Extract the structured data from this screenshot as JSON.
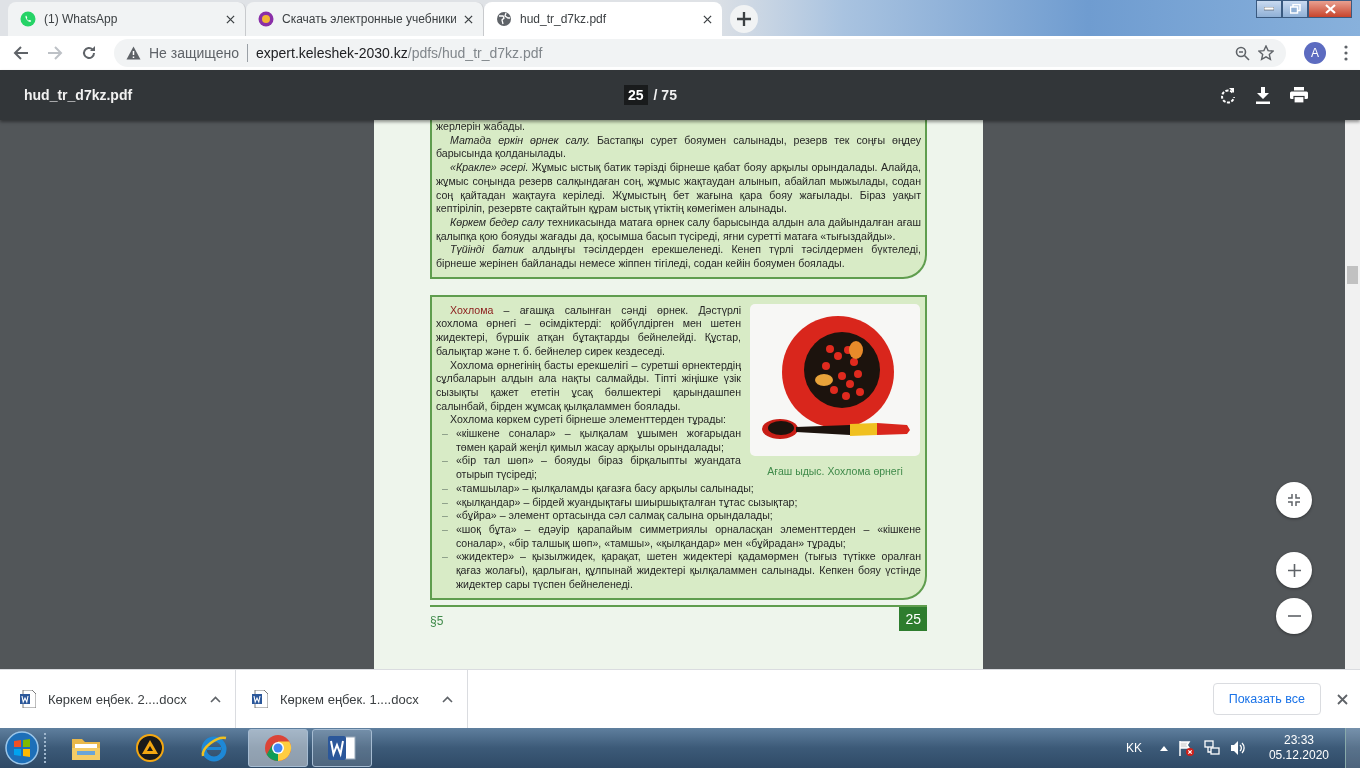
{
  "tabs": [
    {
      "title": "(1) WhatsApp",
      "kind": "whatsapp",
      "selected": false
    },
    {
      "title": "Скачать электронные учебники",
      "kind": "site",
      "selected": false
    },
    {
      "title": "hud_tr_d7kz.pdf",
      "kind": "globe",
      "selected": true
    }
  ],
  "address_bar": {
    "security_label": "Не защищено",
    "url_host": "expert.keleshek-2030.kz",
    "url_path": "/pdfs/hud_tr_d7kz.pdf",
    "profile_initial": "A"
  },
  "pdf_toolbar": {
    "file_name": "hud_tr_d7kz.pdf",
    "page_current": "25",
    "page_total": "/ 75"
  },
  "page": {
    "box_1": {
      "paragraphs": [
        {
          "text": "жерлерін жабады.",
          "indent": false
        },
        {
          "text": "*Матада еркін өрнек салу.* Бастапқы сурет бояумен салынады, резерв тек соңғы өңдеу барысында қолданылады.",
          "indent": true
        },
        {
          "text": "*«Кракле» әсері.* Жұмыс ыстық батик тәрізді бірнеше қабат бояу арқылы орындалады. Алайда, жұмыс соңында резерв салқындаған соң, жұмыс жақтаудан алынып, абайлап мыжылады, содан соң қайтадан жақтауға керіледі. Жұмыстың бет жағына қара бояу жағылады. Біраз уақыт кептіріліп, резервте сақтайтын құрам ыстық үтіктің көмегімен алынады.",
          "indent": true
        },
        {
          "text": "*Көркем бедер салу* техникасында матаға өрнек салу барысында алдын ала дайындалған ағаш қалыпқа қою бояуды жағады да, қосымша басып түсіреді, яғни суретті матаға «тығыздайды».",
          "indent": true
        },
        {
          "text": "*Түйінді батик* алдыңғы тәсілдерден ерекшеленеді. Кенеп түрлі тәсілдермен бүктеледі, бірнеше жерінен байланады немесе жіппен тігіледі, содан кейін бояумен боялады.",
          "indent": true
        }
      ]
    },
    "box_2": {
      "figure_caption": "Ағаш ыдыс. Хохлома өрнегі",
      "paragraphs": [
        {
          "text": "**Хохлома** – ағашқа салынған сәнді өрнек. Дәстүрлі хохлома өрнегі – өсімдіктерді: қойбүлдірген мен шетен жидектері, бүршік атқан бұтақтарды бейнелейді. Құстар, балықтар және т. б. бейнелер сирек кездеседі.",
          "indent": true
        },
        {
          "text": "Хохлома өрнегінің басты ерекшелігі – суретші өрнектердің сұлбаларын алдын ала нақты салмайды. Тіпті жіңішке үзік сызықты қажет ететін ұсақ бөлшектері қарындашпен салынбай, бірден жұмсақ қылқаламмен боялады.",
          "indent": true
        },
        {
          "text": "Хохлома көркем суреті бірнеше элементтерден тұрады:",
          "indent": true
        }
      ],
      "list": [
        {
          "marker": "–",
          "text": "«кішкене соналар» – қылқалам ұшымен жоғарыдан төмен қарай жеңіл қимыл жасау арқылы орындалады;"
        },
        {
          "marker": "–",
          "text": "«бір тал шөп» – бояуды біраз бірқалыпты жуандата отырып түсіреді;"
        },
        {
          "marker": "–",
          "text": "«тамшылар» – қылқаламды қағазға басу арқылы салынады;"
        },
        {
          "marker": "–",
          "text": "«қылқандар» – бірдей жуандықтағы шиыршықталған тұтас сызықтар;"
        },
        {
          "marker": "–",
          "text": "«бұйра» – элемент ортасында сәл салмақ салына орындалады;"
        },
        {
          "marker": "–",
          "text": "«шоқ бұта» – едәуір қарапайым симметриялы орналасқан элементтерден – «кішкене соналар», «бір талшық шөп», «тамшы», «қылқандар» мен «бұйрадан» тұрады;"
        },
        {
          "marker": "–",
          "text": "«жидектер» – қызылжидек, қарақат, шетен жидектері қадамөрмен (тығыз түтікке оралған қағаз жолағы), қарлыған, құлпынай жидектері қылқаламмен салынады. Кепкен бояу үстінде жидектер сары түспен бейнеленеді."
        }
      ]
    },
    "footer": {
      "section": "§5",
      "page_number": "25"
    }
  },
  "downloads": {
    "items": [
      {
        "name": "Көркем еңбек. 2....docx"
      },
      {
        "name": "Көркем еңбек. 1....docx"
      }
    ],
    "show_all_label": "Показать все"
  },
  "taskbar": {
    "apps": [
      {
        "kind": "folder",
        "running": false,
        "active": false
      },
      {
        "kind": "player",
        "running": false,
        "active": false
      },
      {
        "kind": "ie",
        "running": false,
        "active": false
      },
      {
        "kind": "chrome",
        "running": true,
        "active": true
      },
      {
        "kind": "word",
        "running": true,
        "active": false
      }
    ],
    "language": "KK",
    "time": "23:33",
    "date": "05.12.2020"
  }
}
